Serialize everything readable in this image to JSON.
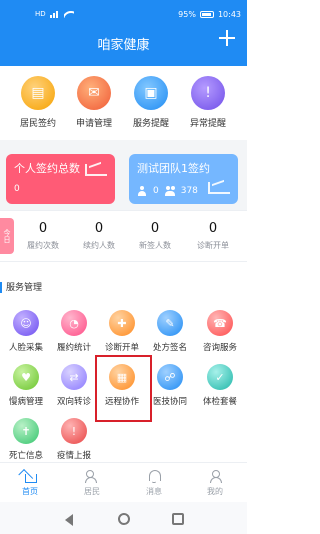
{
  "status_bar": {
    "sim_text": "HD",
    "battery": "95%",
    "time": "10:43"
  },
  "header": {
    "title": "咱家健康"
  },
  "quick_actions": [
    {
      "label": "居民签约",
      "icon": "document-icon"
    },
    {
      "label": "申请管理",
      "icon": "mail-icon"
    },
    {
      "label": "服务提醒",
      "icon": "bag-icon"
    },
    {
      "label": "异常提醒",
      "icon": "warning-icon"
    }
  ],
  "cards": {
    "personal": {
      "title": "个人签约总数",
      "value": "0"
    },
    "team": {
      "title": "测试团队1签约",
      "members": "0",
      "count": "378"
    }
  },
  "today": {
    "tag": "今日",
    "stats": [
      {
        "value": "0",
        "label": "履约次数"
      },
      {
        "value": "0",
        "label": "续约人数"
      },
      {
        "value": "0",
        "label": "新签人数"
      },
      {
        "value": "0",
        "label": "诊断开单"
      }
    ]
  },
  "service_management": {
    "title": "服务管理",
    "items": [
      {
        "label": "人脸采集",
        "icon": "face-icon",
        "color": "#6d4ef0"
      },
      {
        "label": "履约统计",
        "icon": "pie-chart-icon",
        "color": "#ff4c86"
      },
      {
        "label": "诊断开单",
        "icon": "diagnosis-icon",
        "color": "#ff8a1f"
      },
      {
        "label": "处方签名",
        "icon": "pen-icon",
        "color": "#1f8bf3"
      },
      {
        "label": "咨询服务",
        "icon": "consult-icon",
        "color": "#ff4a4a"
      },
      {
        "label": "慢病管理",
        "icon": "medical-icon",
        "color": "#6ac42b"
      },
      {
        "label": "双向转诊",
        "icon": "transfer-icon",
        "color": "#8a78ff"
      },
      {
        "label": "远程协作",
        "icon": "remote-icon",
        "color": "#ff8a1f"
      },
      {
        "label": "医技协同",
        "icon": "handshake-icon",
        "color": "#1f8bf3"
      },
      {
        "label": "体检套餐",
        "icon": "checkup-icon",
        "color": "#1fb6a8"
      },
      {
        "label": "死亡信息",
        "icon": "cross-icon",
        "color": "#35c56d"
      },
      {
        "label": "疫情上报",
        "icon": "alert-icon",
        "color": "#e84343"
      }
    ]
  },
  "tabs": [
    {
      "label": "首页",
      "active": true
    },
    {
      "label": "居民",
      "active": false
    },
    {
      "label": "消息",
      "active": false
    },
    {
      "label": "我的",
      "active": false
    }
  ]
}
